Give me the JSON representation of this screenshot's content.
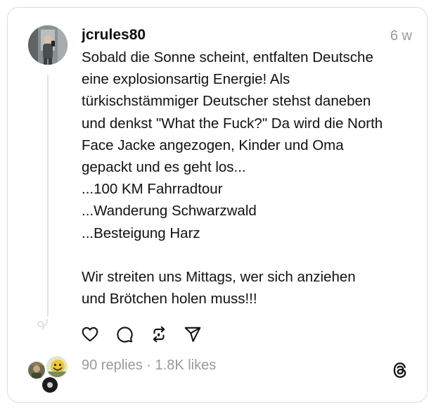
{
  "post": {
    "username": "jcrules80",
    "timestamp": "6 w",
    "lines": [
      "Sobald die Sonne scheint, entfalten Deutsche",
      "eine explosionsartig Energie! Als",
      "türkischstämmiger Deutscher stehst daneben",
      "und denkst \"What the Fuck?\" Da wird die North",
      "Face Jacke angezogen, Kinder und Oma",
      "gepackt und es geht los...",
      "...100 KM Fahrradtour",
      "...Wanderung Schwarzwald",
      "...Besteigung Harz",
      "",
      "Wir streiten uns Mittags, wer sich anziehen",
      "und Brötchen holen muss!!!"
    ]
  },
  "actions": {
    "icons": [
      "heart-icon",
      "comment-icon",
      "repost-icon",
      "share-icon"
    ]
  },
  "stats": {
    "replies": "90 replies",
    "separator": "·",
    "likes": "1.8K likes"
  },
  "brand": {
    "logo": "threads-logo-icon"
  },
  "colors": {
    "text": "#111111",
    "muted": "#9a9a9a",
    "border": "#dcdcdc",
    "thread_line": "#e3e3e3"
  }
}
